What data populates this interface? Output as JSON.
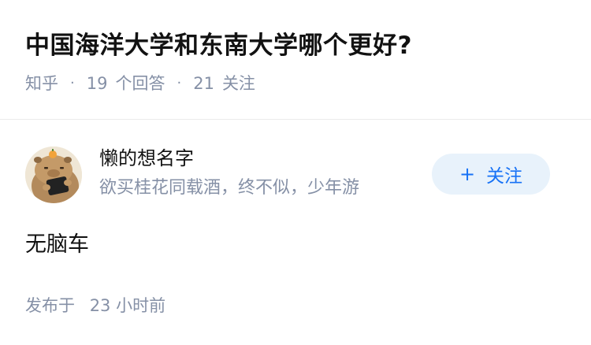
{
  "question": {
    "title": "中国海洋大学和东南大学哪个更好?",
    "source": "知乎",
    "separator": "·",
    "answer_count": "19",
    "answer_label": "个回答",
    "follower_count": "21",
    "follower_label": "关注"
  },
  "author": {
    "name": "懒的想名字",
    "bio": "欲买桂花同载酒，终不似，少年游",
    "avatar_icon": "capybara-avatar-icon"
  },
  "follow": {
    "icon": "+",
    "label": "关注",
    "bg_color": "#e8f2fb",
    "text_color": "#1772f6"
  },
  "answer": {
    "content": "无脑车",
    "time_label": "发布于",
    "time_value": "23 小时前"
  }
}
